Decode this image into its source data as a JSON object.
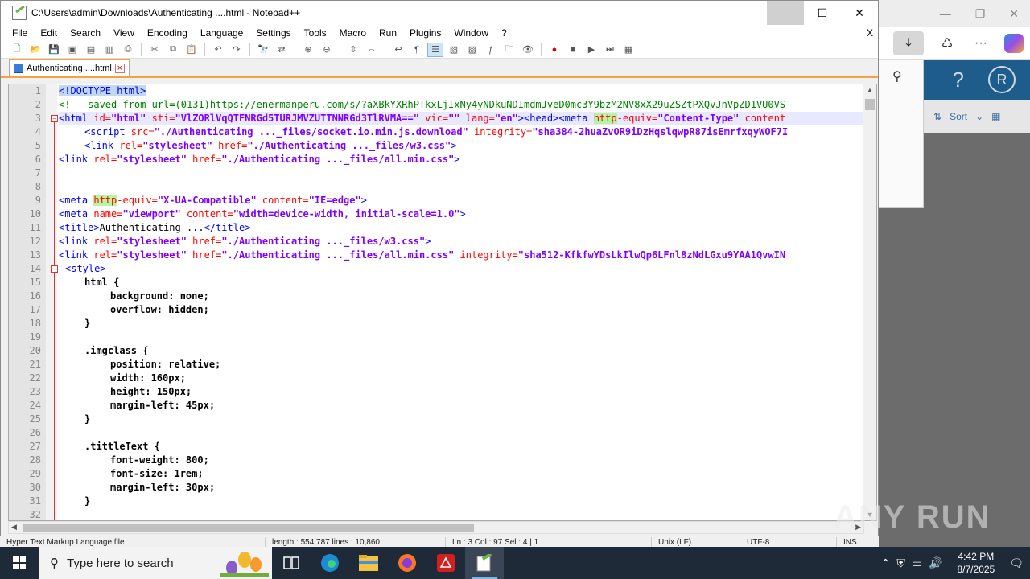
{
  "window": {
    "title": "C:\\Users\\admin\\Downloads\\Authenticating ....html - Notepad++",
    "minimize": "—",
    "maximize": "☐",
    "close": "✕"
  },
  "menu": {
    "items": [
      "File",
      "Edit",
      "Search",
      "View",
      "Encoding",
      "Language",
      "Settings",
      "Tools",
      "Macro",
      "Run",
      "Plugins",
      "Window",
      "?"
    ],
    "close_doc": "X"
  },
  "tab": {
    "label": "Authenticating ....html"
  },
  "editor": {
    "lines": [
      {
        "n": "1"
      },
      {
        "n": "2"
      },
      {
        "n": "3"
      },
      {
        "n": "4"
      },
      {
        "n": "5"
      },
      {
        "n": "6"
      },
      {
        "n": "7"
      },
      {
        "n": "8"
      },
      {
        "n": "9"
      },
      {
        "n": "10"
      },
      {
        "n": "11"
      },
      {
        "n": "12"
      },
      {
        "n": "13"
      },
      {
        "n": "14"
      },
      {
        "n": "15"
      },
      {
        "n": "16"
      },
      {
        "n": "17"
      },
      {
        "n": "18"
      },
      {
        "n": "19"
      },
      {
        "n": "20"
      },
      {
        "n": "21"
      },
      {
        "n": "22"
      },
      {
        "n": "23"
      },
      {
        "n": "24"
      },
      {
        "n": "25"
      },
      {
        "n": "26"
      },
      {
        "n": "27"
      },
      {
        "n": "28"
      },
      {
        "n": "29"
      },
      {
        "n": "30"
      },
      {
        "n": "31"
      },
      {
        "n": "32"
      }
    ],
    "code": {
      "l1": "<!DOCTYPE html>",
      "l2_cmt": "<!-- saved from url=(0131)",
      "l2_url": "https://enermanperu.com/s/?aXBkYXRhPTkxLjIxNy4yNDkuNDImdmJveD0mc3Y9bzM2NV8xX29uZSZtPXQvJnVpZD1VU0VS",
      "l3": [
        "<html",
        " id=",
        "\"html\"",
        " sti=",
        "\"VlZORlVqQTFNRGd5TURJMVZUTTNNRGd3TlRVMA==\"",
        " vic=",
        "\"\"",
        " lang=",
        "\"en\"",
        "><head><meta",
        " ",
        "http",
        "-equiv=",
        "\"Content-Type\"",
        " content"
      ],
      "l4": [
        "<script",
        " src=",
        "\"./Authenticating ..._files/socket.io.min.js.download\"",
        " integrity=",
        "\"sha384-2huaZvOR9iDzHqslqwpR87isEmrfxqyWOF7I"
      ],
      "l5": [
        "<link",
        " rel=",
        "\"stylesheet\"",
        " href=",
        "\"./Authenticating ..._files/w3.css\"",
        ">"
      ],
      "l6": [
        "<link",
        " rel=",
        "\"stylesheet\"",
        " href=",
        "\"./Authenticating ..._files/all.min.css\"",
        ">"
      ],
      "l9": [
        "<meta",
        " ",
        "http",
        "-equiv=",
        "\"X-UA-Compatible\"",
        " content=",
        "\"IE=edge\"",
        ">"
      ],
      "l10": [
        "<meta",
        " name=",
        "\"viewport\"",
        " content=",
        "\"width=device-width, initial-scale=1.0\"",
        ">"
      ],
      "l11": [
        "<title>",
        "Authenticating ...",
        "</title>"
      ],
      "l12": [
        "<link",
        " rel=",
        "\"stylesheet\"",
        " href=",
        "\"./Authenticating ..._files/w3.css\"",
        ">"
      ],
      "l13": [
        "<link",
        " rel=",
        "\"stylesheet\"",
        " href=",
        "\"./Authenticating ..._files/all.min.css\"",
        " integrity=",
        "\"sha512-KfkfwYDsLkIlwQp6LFnl8zNdLGxu9YAA1QvwIN"
      ],
      "l14": "<style>",
      "l15": "html {",
      "l16": "background: none;",
      "l17": "overflow: hidden;",
      "l18": "}",
      "l20": ".imgclass {",
      "l21": "position: relative;",
      "l22": "width: 160px;",
      "l23": "height: 150px;",
      "l24": "margin-left: 45px;",
      "l25": "}",
      "l27": ".tittleText {",
      "l28": "font-weight: 800;",
      "l29": "font-size: 1rem;",
      "l30": "margin-left: 30px;",
      "l31": "}"
    }
  },
  "statusbar": {
    "type": "Hyper Text Markup Language file",
    "length": "length : 554,787    lines : 10,860",
    "pos": "Ln : 3    Col : 97    Sel : 4 | 1",
    "eol": "Unix (LF)",
    "enc": "UTF-8",
    "mode": "INS"
  },
  "browser": {
    "sort_label": "Sort",
    "avatar": "R",
    "help": "?"
  },
  "watermark": "ANY RUN",
  "taskbar": {
    "search_placeholder": "Type here to search",
    "time": "4:42 PM",
    "date": "8/7/2025"
  }
}
